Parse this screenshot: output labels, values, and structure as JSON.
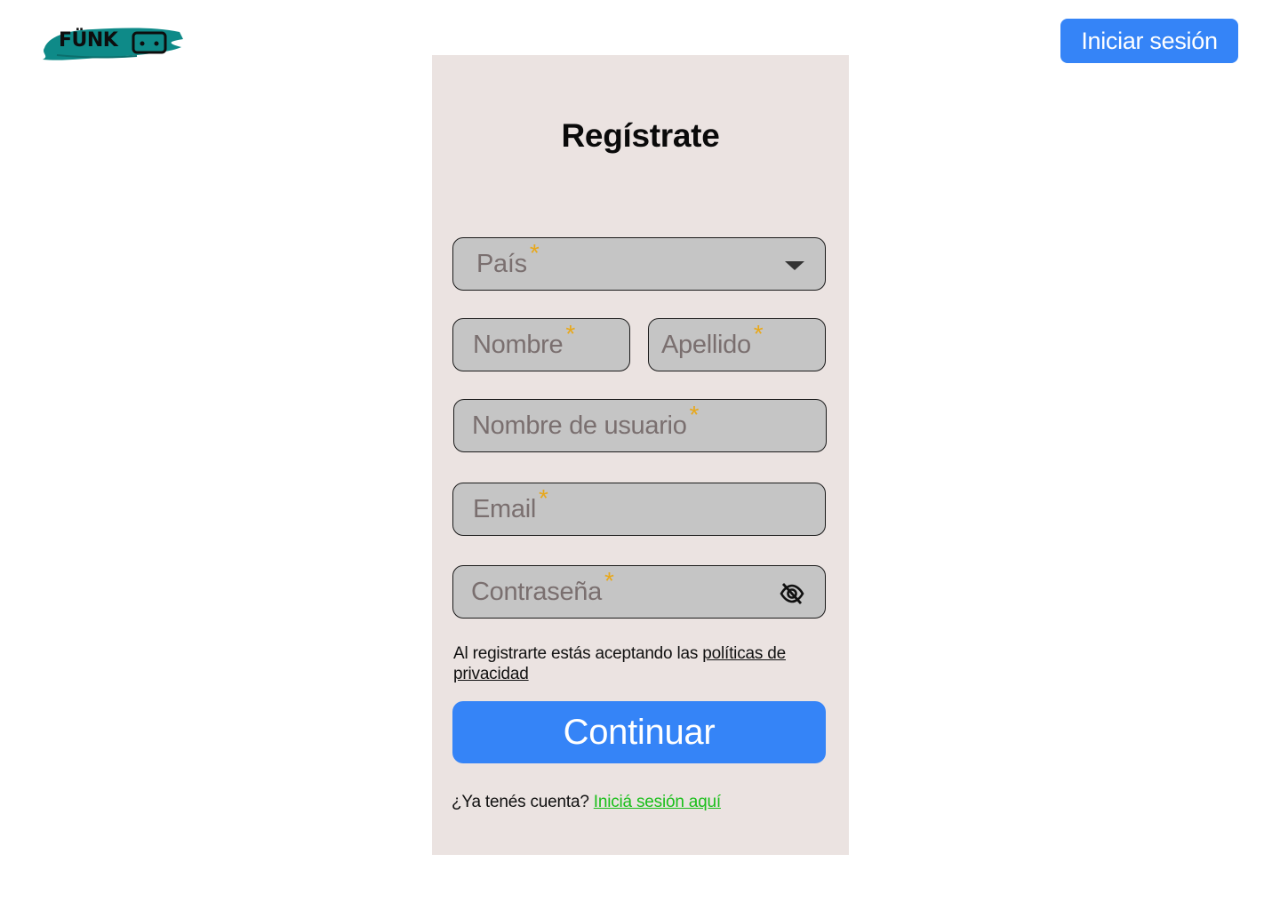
{
  "brand": {
    "logo_text": "FÜNK",
    "logo_color": "#0e8a88"
  },
  "header": {
    "login_button_label": "Iniciar sesión"
  },
  "form": {
    "title": "Regístrate",
    "required_mark": "*",
    "fields": {
      "pais": {
        "placeholder": "País"
      },
      "nombre": {
        "placeholder": "Nombre"
      },
      "apellido": {
        "placeholder": "Apellido"
      },
      "usuario": {
        "placeholder": "Nombre de usuario"
      },
      "email": {
        "placeholder": "Email"
      },
      "password": {
        "placeholder": "Contraseña",
        "icon": "eye-off-icon"
      }
    },
    "policy_text": "Al registrarte estás aceptando las ",
    "policy_link": "políticas de privacidad",
    "continue_label": "Continuar",
    "have_account_text": "¿Ya tenés cuenta? ",
    "login_link": "Iniciá sesión aquí"
  },
  "colors": {
    "primary": "#3584f7",
    "card_bg": "#ebe3e1",
    "field_bg": "#c5c5c5",
    "required": "#e8a81b",
    "link_green": "#1bbf1b"
  }
}
